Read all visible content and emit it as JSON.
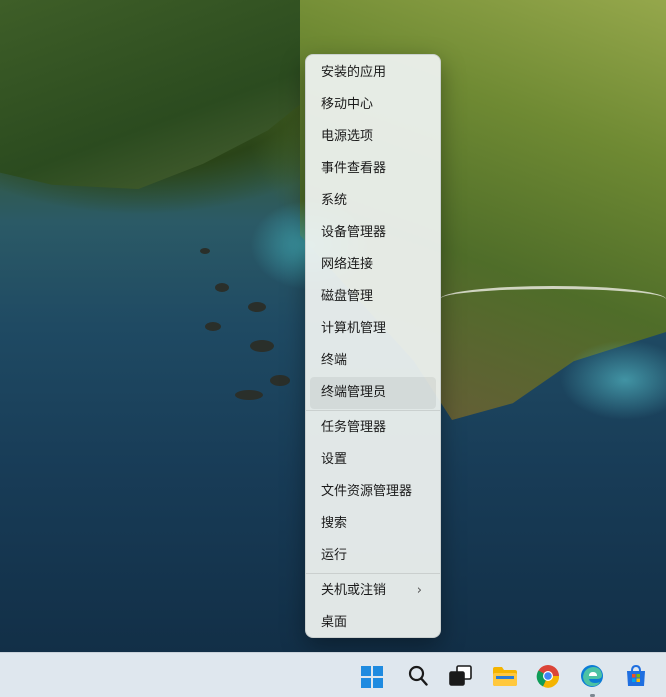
{
  "context_menu": {
    "items_group1": [
      {
        "label": "安装的应用"
      },
      {
        "label": "移动中心"
      },
      {
        "label": "电源选项"
      },
      {
        "label": "事件查看器"
      },
      {
        "label": "系统"
      },
      {
        "label": "设备管理器"
      },
      {
        "label": "网络连接"
      },
      {
        "label": "磁盘管理"
      },
      {
        "label": "计算机管理"
      },
      {
        "label": "终端"
      },
      {
        "label": "终端管理员"
      }
    ],
    "items_group2": [
      {
        "label": "任务管理器"
      },
      {
        "label": "设置"
      },
      {
        "label": "文件资源管理器"
      },
      {
        "label": "搜索"
      },
      {
        "label": "运行"
      }
    ],
    "items_group3": [
      {
        "label": "关机或注销",
        "submenu_icon": "chevron-right-icon"
      },
      {
        "label": "桌面"
      }
    ],
    "highlighted_item": "终端管理员",
    "submenu_chevron": "›"
  },
  "taskbar": {
    "icons": [
      {
        "name": "windows-start-icon",
        "color": "#1f8be0"
      },
      {
        "name": "search-icon",
        "color": "#1a1a1a"
      },
      {
        "name": "task-view-icon",
        "color": "#1a1a1a"
      },
      {
        "name": "file-explorer-icon",
        "color": "#f4b400"
      },
      {
        "name": "chrome-icon",
        "color": "#db4437"
      },
      {
        "name": "edge-icon",
        "color": "#0c7cd5"
      },
      {
        "name": "microsoft-store-icon",
        "color": "#1f6fe0"
      }
    ],
    "active_app": "edge-icon"
  },
  "colors": {
    "menu_background": "#eef2f0",
    "taskbar_background": "#dfe7ee",
    "accent": "#1f8be0"
  }
}
